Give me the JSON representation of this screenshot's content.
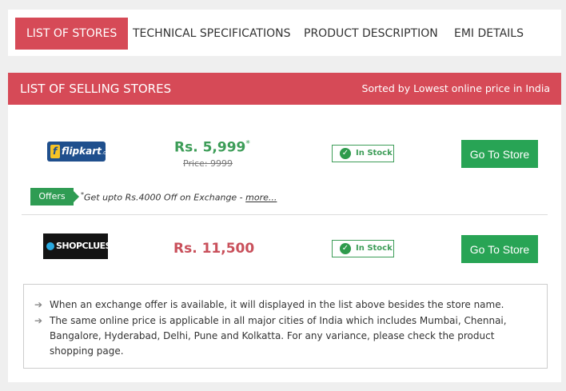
{
  "tabs": [
    {
      "label": "LIST OF STORES",
      "active": true
    },
    {
      "label": "TECHNICAL SPECIFICATIONS",
      "active": false
    },
    {
      "label": "PRODUCT DESCRIPTION",
      "active": false
    },
    {
      "label": "EMI DETAILS",
      "active": false
    }
  ],
  "stores_header": {
    "title": "LIST OF SELLING STORES",
    "sort_text": "Sorted by Lowest online price in India"
  },
  "stores": [
    {
      "logo_text": "flipkart",
      "logo_suffix": ".com",
      "price": "Rs. 5,999",
      "price_mark": "*",
      "old_price": "Price: 9999",
      "stock": "In Stock",
      "button": "Go To Store",
      "offer": {
        "badge": "Offers",
        "mark": "*",
        "text": "Get upto Rs.4000 Off on Exchange - ",
        "link": "more..."
      }
    },
    {
      "logo_text": "SHOPCLUES",
      "price": "Rs. 11,500",
      "stock": "In Stock",
      "button": "Go To Store"
    }
  ],
  "notes": [
    "When an exchange offer is available, it will displayed in the list above besides the store name.",
    "The same online price is applicable in all major cities of India which includes Mumbai, Chennai, Bangalore, Hyderabad, Delhi, Pune and Kolkatta. For any variance, please check the product shopping page."
  ],
  "colors": {
    "accent": "#d64a57",
    "green": "#28a455",
    "price_green": "#3d9d58",
    "price_red": "#c9505b"
  },
  "icons": {
    "check": "check-circle-icon",
    "arrow": "arrow-right-icon"
  }
}
